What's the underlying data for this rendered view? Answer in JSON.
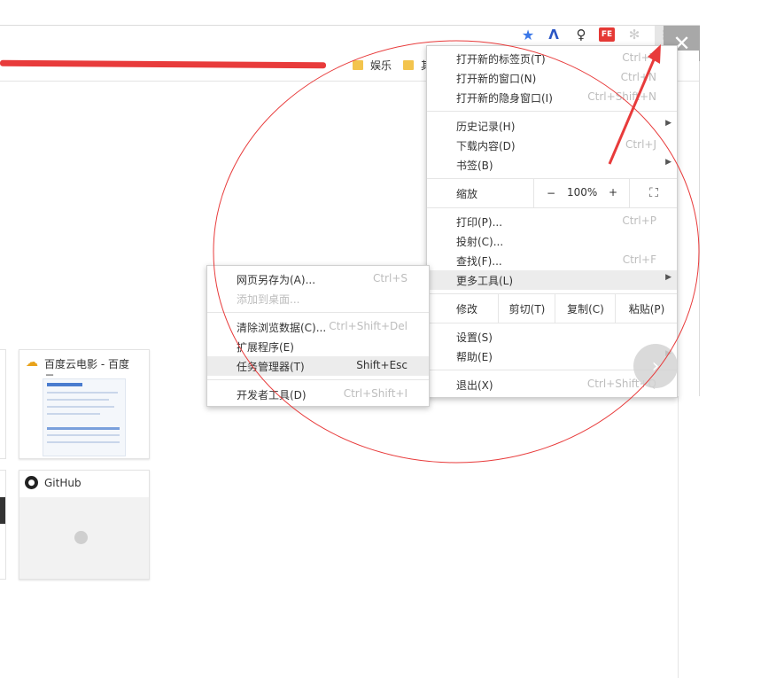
{
  "toolbar": {
    "menu_icon": "⋮",
    "close_icon": "✕",
    "fe_label": "FE"
  },
  "bookmarks": [
    {
      "label": "娱乐"
    },
    {
      "label": "其"
    }
  ],
  "menu": {
    "items": [
      {
        "label": "打开新的标签页(T)",
        "shortcut": "Ctrl+T"
      },
      {
        "label": "打开新的窗口(N)",
        "shortcut": "Ctrl+N"
      },
      {
        "label": "打开新的隐身窗口(I)",
        "shortcut": "Ctrl+Shift+N"
      },
      {
        "label": "历史记录(H)",
        "shortcut": ""
      },
      {
        "label": "下载内容(D)",
        "shortcut": "Ctrl+J"
      },
      {
        "label": "书签(B)",
        "shortcut": ""
      },
      {
        "label": "打印(P)...",
        "shortcut": "Ctrl+P"
      },
      {
        "label": "投射(C)...",
        "shortcut": ""
      },
      {
        "label": "查找(F)...",
        "shortcut": "Ctrl+F"
      },
      {
        "label": "更多工具(L)",
        "shortcut": ""
      },
      {
        "label": "设置(S)",
        "shortcut": ""
      },
      {
        "label": "帮助(E)",
        "shortcut": ""
      },
      {
        "label": "退出(X)",
        "shortcut": "Ctrl+Shift+Q"
      }
    ],
    "zoom": {
      "label": "缩放",
      "minus": "−",
      "value": "100%",
      "plus": "+",
      "fullscreen": "⛶"
    },
    "edit": {
      "label": "修改",
      "cut": "剪切(T)",
      "copy": "复制(C)",
      "paste": "粘贴(P)"
    }
  },
  "submenu": {
    "items": [
      {
        "label": "网页另存为(A)...",
        "shortcut": "Ctrl+S"
      },
      {
        "label": "添加到桌面...",
        "shortcut": ""
      },
      {
        "label": "清除浏览数据(C)...",
        "shortcut": "Ctrl+Shift+Del"
      },
      {
        "label": "扩展程序(E)",
        "shortcut": ""
      },
      {
        "label": "任务管理器(T)",
        "shortcut": "Shift+Esc"
      },
      {
        "label": "开发者工具(D)",
        "shortcut": "Ctrl+Shift+I"
      }
    ]
  },
  "tiles": [
    {
      "title": "百度云电影 - 百度云..."
    },
    {
      "title": "GitHub"
    }
  ],
  "colors": {
    "annotation": "#e83b3b",
    "highlight": "#ececec"
  }
}
